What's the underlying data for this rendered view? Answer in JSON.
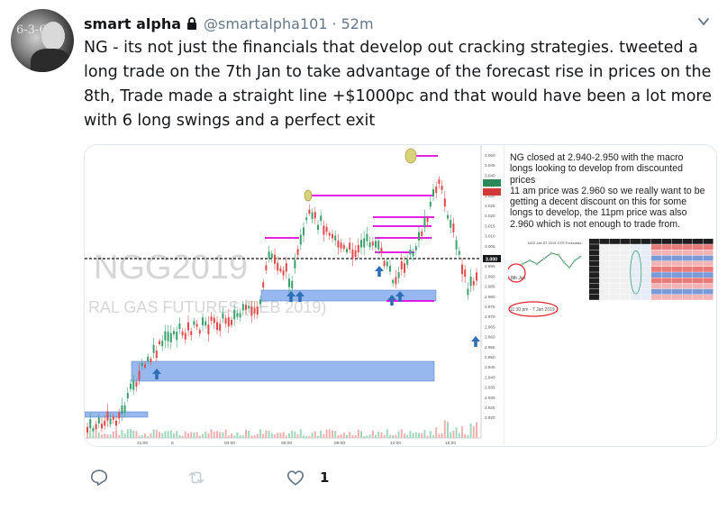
{
  "tweet": {
    "author_name": "smart alpha",
    "handle": "@smartalpha101",
    "separator": "·",
    "time": "52m",
    "text": "NG - its not just the financials that develop out cracking strategies.  tweeted a long trade on the 7th Jan to take advantage of the forecast rise in prices on the 8th,  Trade made a straight line +$1000pc and that would have been a lot more with 6 long swings and a perfect exit",
    "avatar_chalk": "6-3-6"
  },
  "media": {
    "watermark_title": "NGG2019",
    "watermark_subtitle": "RAL GAS FUTURES (FEB 2019)",
    "price_axis": [
      "3.050",
      "3.045",
      "3.040",
      "3.035",
      "3.030",
      "3.025",
      "3.020",
      "3.015",
      "3.010",
      "3.005",
      "3.000",
      "2.995",
      "2.990",
      "2.985",
      "2.980",
      "2.975",
      "2.970",
      "2.965",
      "2.960",
      "2.955",
      "2.950",
      "2.945",
      "2.940",
      "2.935",
      "2.930",
      "2.925",
      "2.920"
    ],
    "current_price_tag": "3.000",
    "time_axis": [
      "21:00",
      "8",
      "03:00",
      "06:00",
      "09:00",
      "12:00",
      "15:00"
    ],
    "side_note_lines": [
      "NG closed at 2.940-2.950 with the macro",
      "longs looking to develop from discounted",
      "prices",
      "11 am price was 2.960 so we really want to be",
      "getting a decent discount on this for some",
      "longs to develop, the 11pm price was also",
      "2.960 which is not enough to trade from."
    ],
    "forecast_title": "NG2 Jan 07 2019 GTS Forecasts",
    "forecast_circle_label": "8th Jan",
    "forecast_time_label": "11:30 pm - 7 Jan 2019"
  },
  "actions": {
    "reply_label": "Reply",
    "retweet_label": "Retweet",
    "like_label": "Like",
    "like_count": "1"
  },
  "colors": {
    "text": "#14171a",
    "muted": "#657786",
    "magenta_line": "#e100e1",
    "support_box": "#6f9ce8",
    "arrow_blue": "#2f6fb8",
    "annotation_red": "#e0202a"
  }
}
